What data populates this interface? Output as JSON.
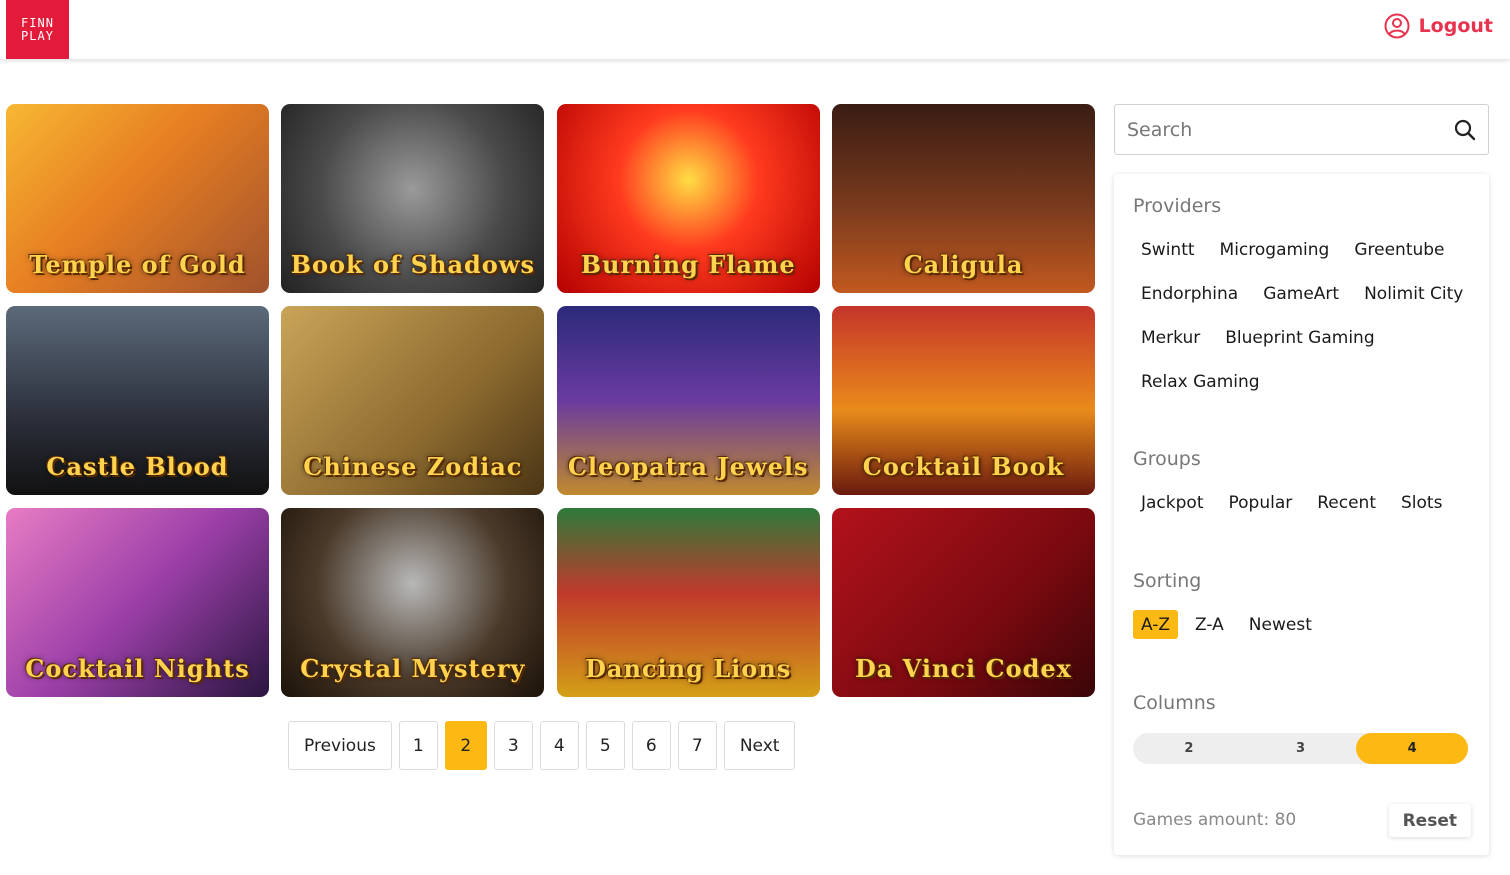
{
  "header": {
    "logo_line1": "FINN",
    "logo_line2": "PLAY",
    "logout_label": "Logout",
    "accent_color": "#e8334f"
  },
  "games": [
    {
      "title": "Temple of Gold",
      "bg": "linear-gradient(135deg,#f7b733 0%,#e67e22 45%,#a0522d 100%)"
    },
    {
      "title": "Book of Shadows",
      "bg": "radial-gradient(circle at 50% 45%,#9a9a9a 0%,#4a4a4a 55%,#222 100%)"
    },
    {
      "title": "Burning Flame",
      "bg": "radial-gradient(circle at 50% 40%,#ffdd44 0%,#ff3b1f 40%,#b30000 100%)"
    },
    {
      "title": "Caligula",
      "bg": "linear-gradient(180deg,#3a1c14 0%,#7a3b1e 55%,#c2591f 100%)"
    },
    {
      "title": "Castle Blood",
      "bg": "linear-gradient(180deg,#5b6a7a 0%,#2b2f3a 60%,#111 100%)"
    },
    {
      "title": "Chinese Zodiac",
      "bg": "linear-gradient(135deg,#c9a458 0%,#8c6a2f 60%,#4a3515 100%)"
    },
    {
      "title": "Cleopatra Jewels",
      "bg": "linear-gradient(180deg,#2b2a7a 0%,#6a3ba0 50%,#c08a2e 100%)"
    },
    {
      "title": "Cocktail Book",
      "bg": "linear-gradient(180deg,#c4352a 0%,#e98b1b 55%,#6a1a0f 100%)"
    },
    {
      "title": "Cocktail Nights",
      "bg": "linear-gradient(135deg,#e87cc4 0%,#9b3fa8 50%,#2a1640 100%)"
    },
    {
      "title": "Crystal Mystery",
      "bg": "radial-gradient(circle at 50% 40%,#b8b8b8 0%,#4a3a2a 55%,#1c1208 100%)"
    },
    {
      "title": "Dancing Lions",
      "bg": "linear-gradient(180deg,#2e7a3a 0%,#c0392b 45%,#d4a017 100%)"
    },
    {
      "title": "Da Vinci Codex",
      "bg": "linear-gradient(135deg,#b3121b 0%,#7a0a10 60%,#3a0508 100%)"
    }
  ],
  "pagination": {
    "previous": "Previous",
    "pages": [
      "1",
      "2",
      "3",
      "4",
      "5",
      "6",
      "7"
    ],
    "current": "2",
    "next": "Next"
  },
  "sidebar": {
    "search_placeholder": "Search",
    "providers_title": "Providers",
    "providers": [
      "Swintt",
      "Microgaming",
      "Greentube",
      "Endorphina",
      "GameArt",
      "Nolimit City",
      "Merkur",
      "Blueprint Gaming",
      "Relax Gaming"
    ],
    "groups_title": "Groups",
    "groups": [
      "Jackpot",
      "Popular",
      "Recent",
      "Slots"
    ],
    "sorting_title": "Sorting",
    "sorting": [
      "A-Z",
      "Z-A",
      "Newest"
    ],
    "sorting_selected": "A-Z",
    "columns_title": "Columns",
    "columns": [
      "2",
      "3",
      "4"
    ],
    "columns_selected": "4",
    "games_amount_label": "Games amount: 80",
    "reset_label": "Reset",
    "highlight_color": "#fdb913"
  }
}
